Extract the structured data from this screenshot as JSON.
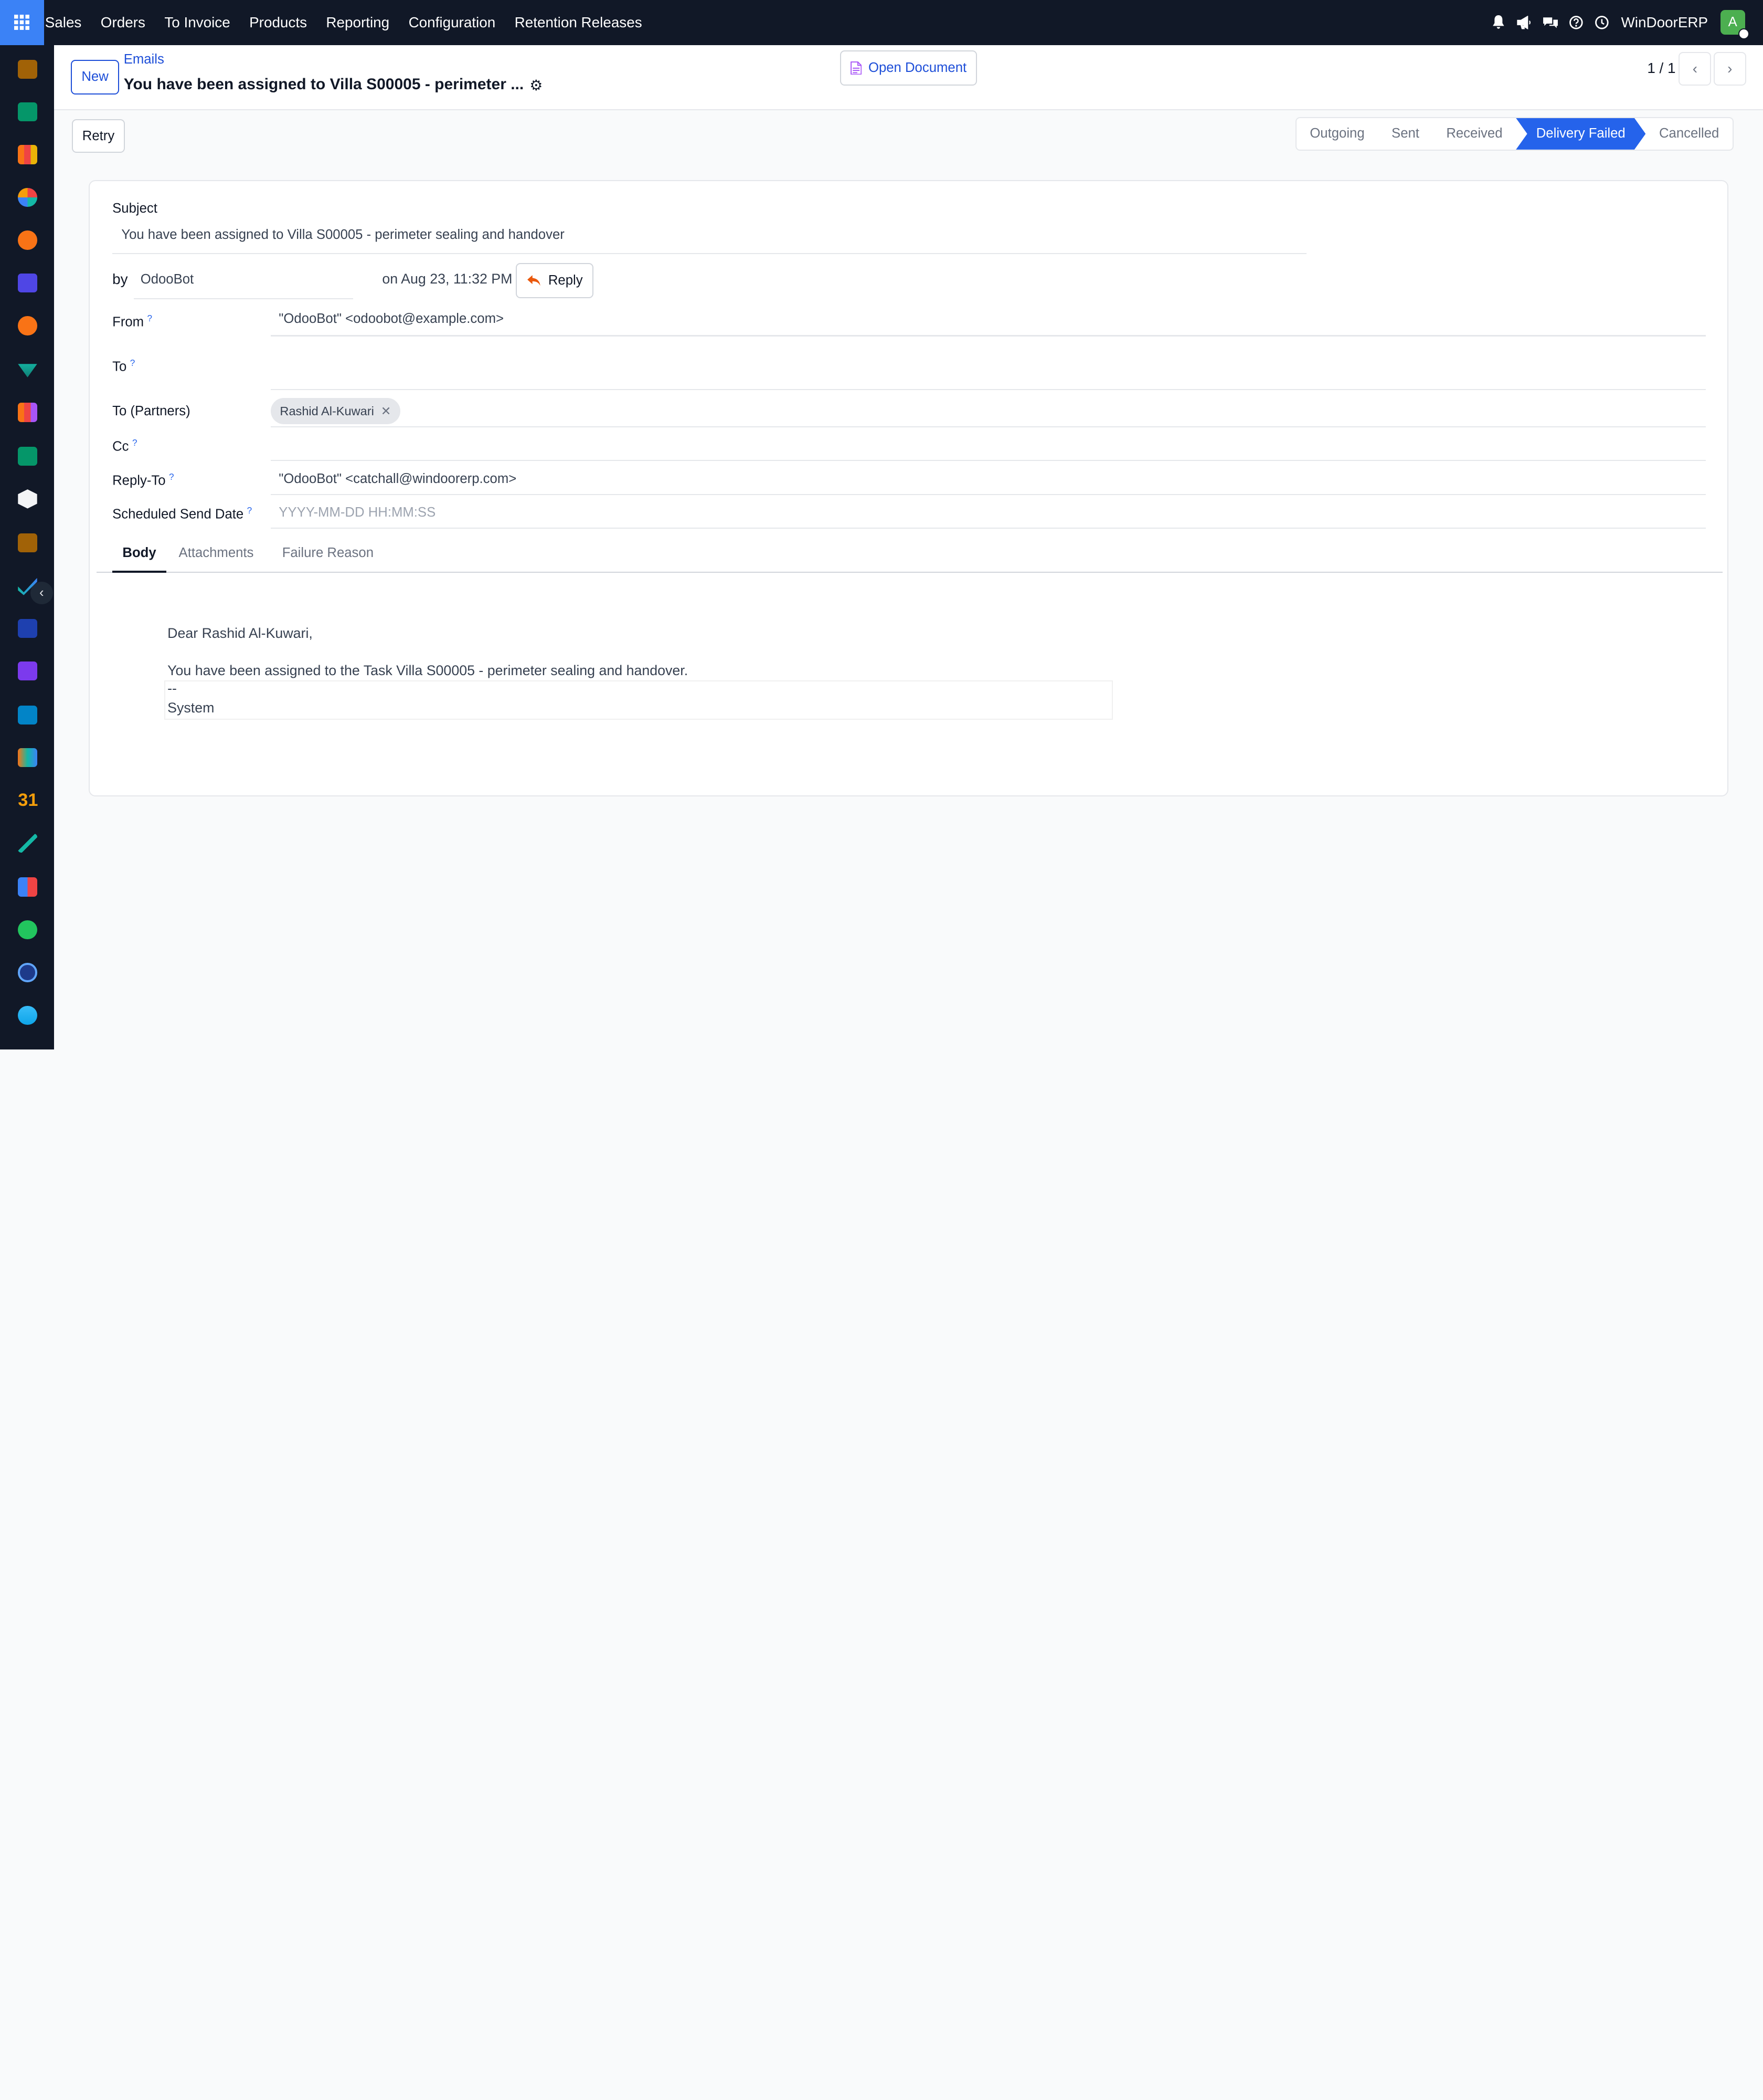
{
  "topnav": {
    "menu": [
      "Sales",
      "Orders",
      "To Invoice",
      "Products",
      "Reporting",
      "Configuration",
      "Retention Releases"
    ],
    "company": "WinDoorERP",
    "avatar_letter": "A"
  },
  "control_panel": {
    "new_label": "New",
    "breadcrumb": "Emails",
    "record_title": "You have been assigned to Villa S00005 - perimeter ...",
    "open_document_label": "Open Document",
    "pager": "1 / 1"
  },
  "statusbar": {
    "retry_label": "Retry",
    "states": [
      "Outgoing",
      "Sent",
      "Received",
      "Delivery Failed",
      "Cancelled"
    ],
    "active_state": "Delivery Failed"
  },
  "form": {
    "subject_label": "Subject",
    "subject": "You have been assigned to Villa S00005 - perimeter sealing and handover",
    "by_label": "by",
    "author": "OdooBot",
    "date_text": "on Aug 23, 11:32 PM",
    "reply_label": "Reply",
    "from_label": "From",
    "from": "\"OdooBot\" <odoobot@example.com>",
    "to_label": "To",
    "to": "",
    "to_partners_label": "To (Partners)",
    "partner_tag": "Rashid Al-Kuwari",
    "cc_label": "Cc",
    "reply_to_label": "Reply-To",
    "reply_to": "\"OdooBot\" <catchall@windoorerp.com>",
    "scheduled_label": "Scheduled Send Date",
    "scheduled_placeholder": "YYYY-MM-DD HH:MM:SS",
    "help_mark": "?"
  },
  "tabs": [
    "Body",
    "Attachments",
    "Failure Reason"
  ],
  "body": {
    "greeting": "Dear Rashid Al-Kuwari,",
    "line1": "You have been assigned to the Task Villa S00005 - perimeter sealing and handover.",
    "sig_sep": "--",
    "signature": "System"
  },
  "colors": {
    "accent": "#2563eb",
    "nav": "#111827",
    "avatar": "#4caf50"
  }
}
